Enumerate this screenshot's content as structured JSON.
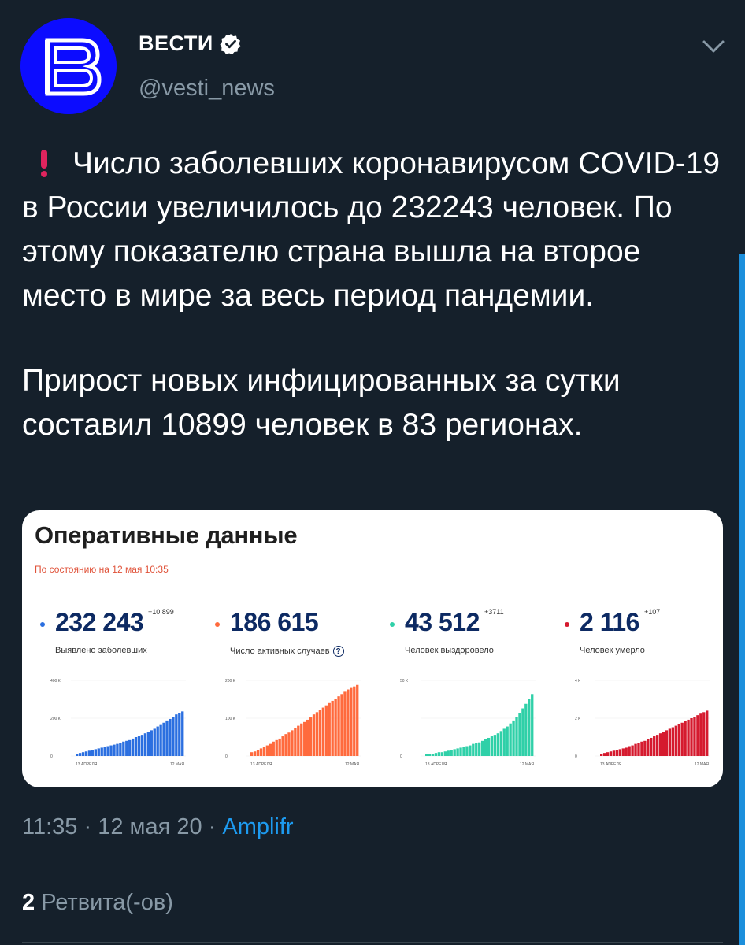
{
  "account": {
    "name": "ВЕСТИ",
    "handle": "@vesti_news",
    "avatar_letter": "В",
    "avatar_color": "#0c0cff"
  },
  "tweet": {
    "para1": "Число заболевших коронавирусом COVID-19 в России увеличилось до 232243 человек. По этому показателю страна вышла на второе место в мире за весь период пандемии.",
    "para2": "Прирост новых инфицированных за сутки составил 10899 человек в 83 регионах."
  },
  "card": {
    "title": "Оперативные данные",
    "date": "По состоянию на 12 мая 10:35",
    "stats": [
      {
        "value": "232 243",
        "delta": "+10 899",
        "label": "Выявлено заболевших",
        "color": "#2b6fe0",
        "y_ticks": [
          "400 К",
          "200 К",
          "0"
        ],
        "x_start": "13 АПРЕЛЯ",
        "x_end": "12 МАЯ"
      },
      {
        "value": "186 615",
        "delta": "",
        "label": "Число активных случаев",
        "color": "#ff6a3d",
        "y_ticks": [
          "200 К",
          "100 К",
          "0"
        ],
        "x_start": "13 АПРЕЛЯ",
        "x_end": "12 МАЯ"
      },
      {
        "value": "43 512",
        "delta": "+3711",
        "label": "Человек выздоровело",
        "color": "#2fd0a8",
        "y_ticks": [
          "50 К",
          "",
          "0"
        ],
        "x_start": "13 АПРЕЛЯ",
        "x_end": "12 МАЯ"
      },
      {
        "value": "2 116",
        "delta": "+107",
        "label": "Человек умерло",
        "color": "#d51a2e",
        "y_ticks": [
          "4 К",
          "2 К",
          "0"
        ],
        "x_start": "13 АПРЕЛЯ",
        "x_end": "12 МАЯ"
      }
    ],
    "series_fill_levels": [
      [
        0.03,
        0.04,
        0.05,
        0.06,
        0.07,
        0.08,
        0.09,
        0.1,
        0.11,
        0.12,
        0.13,
        0.14,
        0.15,
        0.16,
        0.17,
        0.19,
        0.2,
        0.21,
        0.23,
        0.25,
        0.26,
        0.28,
        0.3,
        0.32,
        0.34,
        0.36,
        0.39,
        0.41,
        0.44,
        0.47,
        0.49,
        0.52,
        0.55,
        0.57,
        0.59
      ],
      [
        0.05,
        0.06,
        0.08,
        0.1,
        0.12,
        0.14,
        0.16,
        0.19,
        0.21,
        0.23,
        0.26,
        0.29,
        0.31,
        0.34,
        0.37,
        0.4,
        0.43,
        0.45,
        0.48,
        0.51,
        0.55,
        0.58,
        0.61,
        0.64,
        0.67,
        0.7,
        0.73,
        0.76,
        0.79,
        0.82,
        0.85,
        0.88,
        0.9,
        0.92,
        0.94
      ],
      [
        0.02,
        0.03,
        0.03,
        0.04,
        0.05,
        0.05,
        0.06,
        0.07,
        0.08,
        0.09,
        0.1,
        0.11,
        0.12,
        0.13,
        0.14,
        0.16,
        0.17,
        0.18,
        0.2,
        0.22,
        0.24,
        0.26,
        0.28,
        0.3,
        0.33,
        0.36,
        0.39,
        0.43,
        0.47,
        0.52,
        0.57,
        0.63,
        0.69,
        0.75,
        0.82
      ],
      [
        0.03,
        0.04,
        0.05,
        0.06,
        0.07,
        0.08,
        0.09,
        0.1,
        0.11,
        0.13,
        0.14,
        0.16,
        0.17,
        0.19,
        0.2,
        0.22,
        0.24,
        0.26,
        0.28,
        0.3,
        0.32,
        0.34,
        0.36,
        0.38,
        0.4,
        0.42,
        0.44,
        0.46,
        0.48,
        0.5,
        0.52,
        0.54,
        0.56,
        0.58,
        0.6
      ]
    ]
  },
  "meta": {
    "time": "11:35 · 12 мая 20 · ",
    "source": "Amplifr"
  },
  "retweets": {
    "count": "2",
    "label": " Ретвита(-ов)"
  }
}
